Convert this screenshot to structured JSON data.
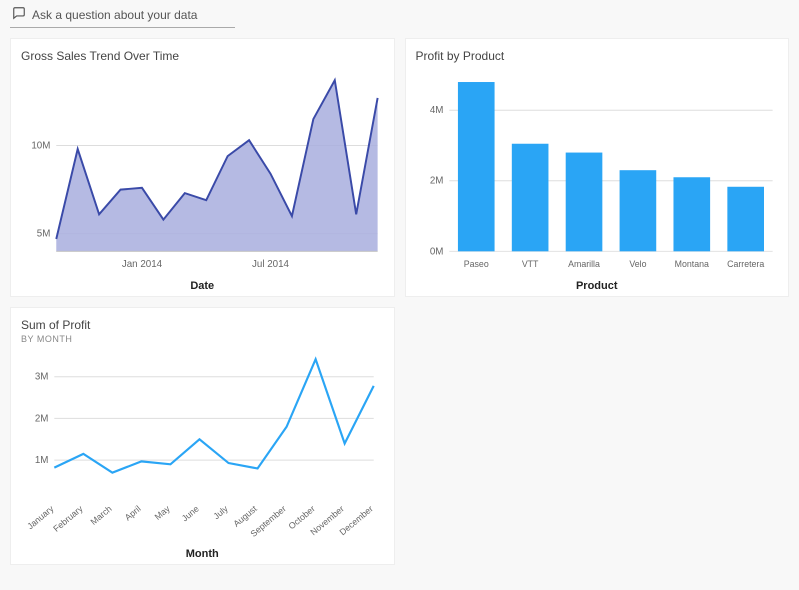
{
  "qa": {
    "placeholder": "Ask a question about your data"
  },
  "tiles": {
    "gross_sales": {
      "title": "Gross Sales Trend Over Time",
      "xlabel": "Date"
    },
    "profit_by_product": {
      "title": "Profit by Product",
      "xlabel": "Product"
    },
    "sum_of_profit": {
      "title": "Sum of Profit",
      "subtitle": "BY MONTH",
      "xlabel": "Month"
    }
  },
  "colors": {
    "area_fill": "#a8aede",
    "area_stroke": "#3a4aa8",
    "bar_fill": "#2aa5f5",
    "line_stroke": "#2aa5f5",
    "tick": "#666666"
  },
  "chart_data": [
    {
      "id": "gross_sales",
      "type": "area",
      "title": "Gross Sales Trend Over Time",
      "xlabel": "Date",
      "ylabel": "",
      "ylim": [
        4000000,
        14000000
      ],
      "x_ticks": [
        "Jan 2014",
        "Jul 2014"
      ],
      "y_ticks": [
        {
          "v": 5000000,
          "label": "5M"
        },
        {
          "v": 10000000,
          "label": "10M"
        }
      ],
      "x": [
        "Sep 2013",
        "Oct 2013",
        "Nov 2013",
        "Dec 2013",
        "Jan 2014",
        "Feb 2014",
        "Mar 2014",
        "Apr 2014",
        "May 2014",
        "Jun 2014",
        "Jul 2014",
        "Aug 2014",
        "Sep 2014",
        "Oct 2014",
        "Nov 2014",
        "Dec 2014"
      ],
      "values": [
        4700000,
        9800000,
        6100000,
        7500000,
        7600000,
        5800000,
        7300000,
        6900000,
        9400000,
        10300000,
        8400000,
        6000000,
        11500000,
        13700000,
        6100000,
        12700000
      ]
    },
    {
      "id": "profit_by_product",
      "type": "bar",
      "title": "Profit by Product",
      "xlabel": "Product",
      "ylabel": "",
      "ylim": [
        0,
        5000000
      ],
      "y_ticks": [
        {
          "v": 0,
          "label": "0M"
        },
        {
          "v": 2000000,
          "label": "2M"
        },
        {
          "v": 4000000,
          "label": "4M"
        }
      ],
      "categories": [
        "Paseo",
        "VTT",
        "Amarilla",
        "Velo",
        "Montana",
        "Carretera"
      ],
      "values": [
        4800000,
        3050000,
        2800000,
        2300000,
        2100000,
        1830000
      ]
    },
    {
      "id": "sum_of_profit",
      "type": "line",
      "title": "Sum of Profit",
      "subtitle": "BY MONTH",
      "xlabel": "Month",
      "ylabel": "",
      "ylim": [
        0,
        3500000
      ],
      "y_ticks": [
        {
          "v": 1000000,
          "label": "1M"
        },
        {
          "v": 2000000,
          "label": "2M"
        },
        {
          "v": 3000000,
          "label": "3M"
        }
      ],
      "categories": [
        "January",
        "February",
        "March",
        "April",
        "May",
        "June",
        "July",
        "August",
        "September",
        "October",
        "November",
        "December"
      ],
      "values": [
        820000,
        1150000,
        700000,
        970000,
        900000,
        1500000,
        930000,
        800000,
        1800000,
        3420000,
        1400000,
        2780000
      ]
    }
  ]
}
